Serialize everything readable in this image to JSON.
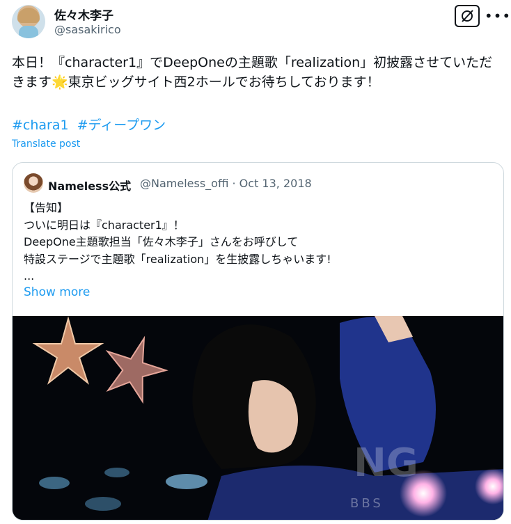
{
  "author": {
    "name": "佐々木李子",
    "handle": "@sasakirico"
  },
  "tweet": {
    "text": "本日！『character1』でDeepOneの主題歌「realization」初披露させていただきます🌟東京ビッグサイト西2ホールでお待ちしております！",
    "hashtags": [
      "#chara1",
      "#ディープワン"
    ],
    "translate_label": "Translate post"
  },
  "quote": {
    "name": "Nameless公式",
    "meta": "@Nameless_offi · Oct 13, 2018",
    "text": "【告知】\nついに明日は『character1』！\nDeepOne主題歌担当「佐々木李子」さんをお呼びして\n特設ステージで主題歌「realization」を生披露しちゃいます!\n...",
    "show_more": "Show more"
  },
  "icons": [
    "avatar",
    "grok-icon",
    "more-icon",
    "quote-avatar",
    "media-image"
  ]
}
